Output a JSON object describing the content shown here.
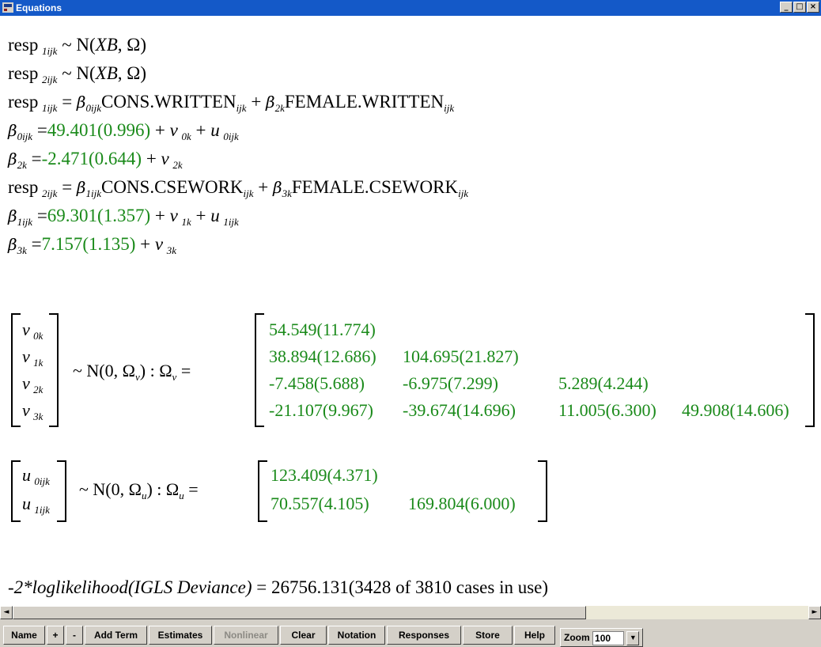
{
  "window": {
    "title": "Equations",
    "minimize": "_",
    "maximize": "□",
    "close": "×"
  },
  "equations": {
    "resp1": "resp",
    "resp1_sub": "1ijk",
    "dist1": "~ N(",
    "xb": "XB",
    "comma_omega": ", Ω)",
    "resp2": "resp",
    "resp2_sub": "2ijk",
    "eq": "=",
    "plus": "+",
    "beta": "β",
    "b0_sub": "0ijk",
    "b1_sub": "1ijk",
    "b2_sub": "2k",
    "b3_sub": "3k",
    "cons_written": "CONS.WRITTEN",
    "female_written": "FEMALE.WRITTEN",
    "cons_csework": "CONS.CSEWORK",
    "female_csework": "FEMALE.CSEWORK",
    "ijk": "ijk",
    "b0_est": "49.401(0.996)",
    "b2_est": "-2.471(0.644)",
    "b1_est": "69.301(1.357)",
    "b3_est": "7.157(1.135)",
    "v": "v",
    "u": "u",
    "v0_sub": "0k",
    "v1_sub": "1k",
    "v2_sub": "2k",
    "v3_sub": "3k",
    "u0_sub": "0ijk",
    "u1_sub": "1ijk"
  },
  "level3": {
    "dist": "~ N(0,  Ω",
    "dist_sub": "v",
    "dist_end": ")  :  Ω",
    "omega_sub": "v",
    "eq": " =",
    "matrix": [
      [
        "54.549(11.774)"
      ],
      [
        "38.894(12.686)",
        "104.695(21.827)"
      ],
      [
        "-7.458(5.688)",
        "-6.975(7.299)",
        "5.289(4.244)"
      ],
      [
        "-21.107(9.967)",
        "-39.674(14.696)",
        "11.005(6.300)",
        "49.908(14.606)"
      ]
    ]
  },
  "level2": {
    "dist": "~ N(0,  Ω",
    "dist_sub": "u",
    "dist_end": ")  :  Ω",
    "omega_sub": "u",
    "eq": " =",
    "matrix": [
      [
        "123.409(4.371)"
      ],
      [
        "70.557(4.105)",
        "169.804(6.000)"
      ]
    ]
  },
  "deviance": {
    "label": "-2*loglikelihood(IGLS Deviance)",
    "eq": " = ",
    "value": "26756.131(3428 of 3810 cases in use)"
  },
  "scrollbar": {
    "left": "◄",
    "right": "►"
  },
  "toolbar": {
    "name": "Name",
    "plus": "+",
    "minus": "-",
    "add_term": "Add Term",
    "estimates": "Estimates",
    "nonlinear": "Nonlinear",
    "clear": "Clear",
    "notation": "Notation",
    "responses": "Responses",
    "store": "Store",
    "help": "Help",
    "zoom_label": "Zoom",
    "zoom_value": "100"
  }
}
